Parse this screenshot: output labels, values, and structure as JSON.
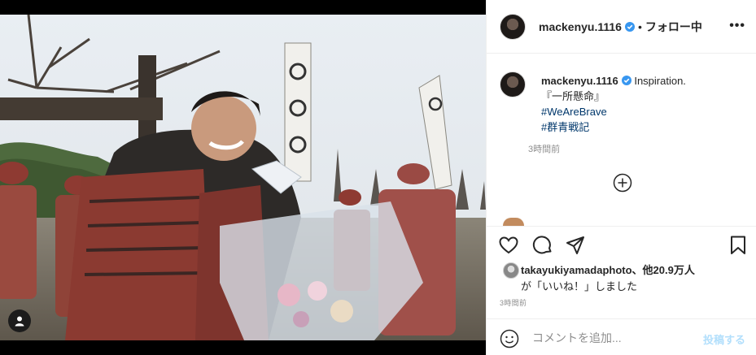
{
  "post": {
    "username": "mackenyu.1116",
    "follow_separator": "•",
    "follow_state": "フォロー中",
    "more_label": "•••"
  },
  "caption": {
    "username": "mackenyu.1116",
    "text": "Inspiration.",
    "line2": "『一所懸命』",
    "hashtags": [
      "#WeAreBrave",
      "#群青戦記"
    ],
    "time_ago": "3時間前"
  },
  "likes": {
    "line1": "takayukiyamadaphoto、他20.9万人",
    "line2": "が「いいね！」しました"
  },
  "post_time": "3時間前",
  "comment": {
    "placeholder": "コメントを追加...",
    "post_label": "投稿する"
  },
  "colors": {
    "verified": "#3897f0",
    "hashtag": "#00376b",
    "post_button_disabled": "#b2dffc",
    "muted": "#8e8e8e"
  },
  "icons": [
    "tag-user-icon",
    "verified-icon",
    "more-options-icon",
    "load-more-comments-icon",
    "heart-icon",
    "comment-icon",
    "share-icon",
    "bookmark-icon",
    "emoji-icon"
  ]
}
